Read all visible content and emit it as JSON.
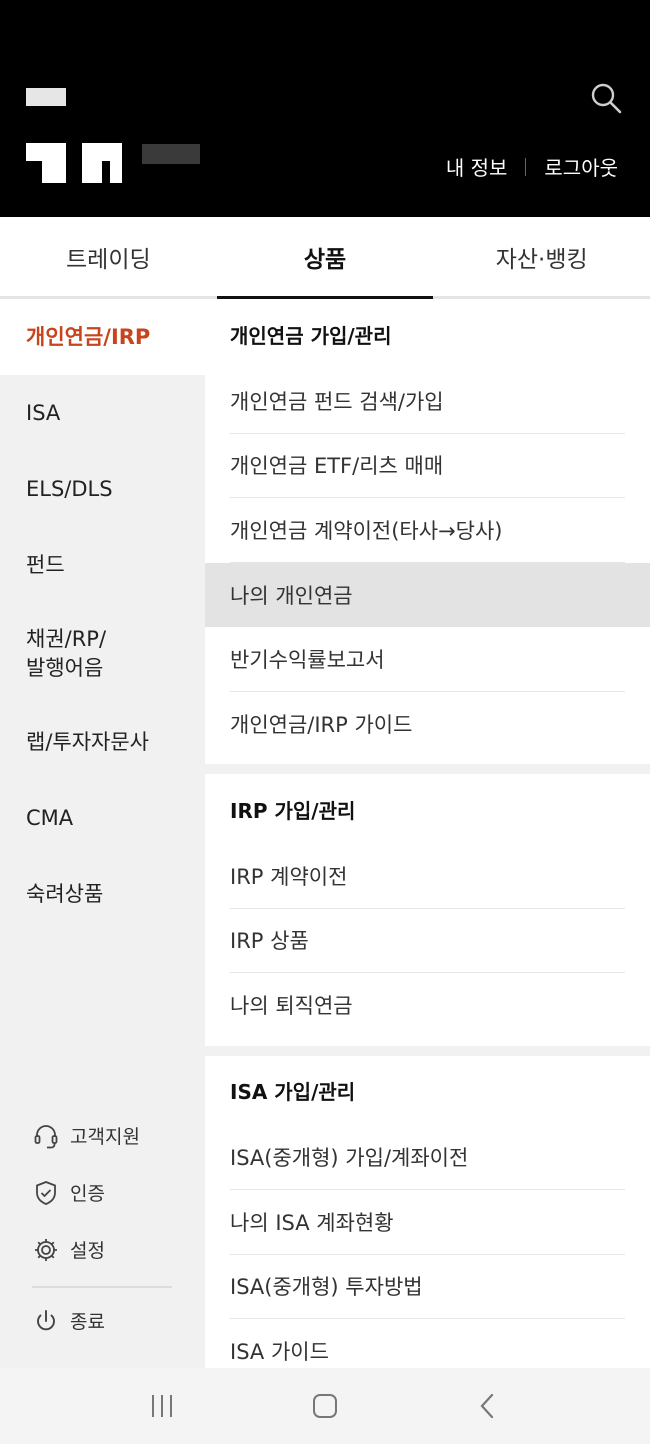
{
  "header": {
    "links": [
      "내 정보",
      "로그아웃"
    ]
  },
  "tabs": [
    {
      "label": "트레이딩",
      "active": false
    },
    {
      "label": "상품",
      "active": true
    },
    {
      "label": "자산·뱅킹",
      "active": false
    }
  ],
  "leftnav": {
    "items": [
      {
        "label": "개인연금/IRP",
        "active": true
      },
      {
        "label": "ISA"
      },
      {
        "label": "ELS/DLS"
      },
      {
        "label": "펀드"
      },
      {
        "label": "채권/RP/\n발행어음"
      },
      {
        "label": "랩/투자자문사"
      },
      {
        "label": "CMA"
      },
      {
        "label": "숙려상품"
      }
    ],
    "utilities": [
      {
        "label": "고객지원",
        "icon": "headset-icon"
      },
      {
        "label": "인증",
        "icon": "shield-check-icon"
      },
      {
        "label": "설정",
        "icon": "gear-icon"
      },
      {
        "label": "종료",
        "icon": "power-icon"
      }
    ]
  },
  "sections": [
    {
      "title": "개인연금 가입/관리",
      "links": [
        "개인연금 펀드 검색/가입",
        "개인연금 ETF/리츠 매매",
        "개인연금 계약이전(타사→당사)",
        "나의 개인연금",
        "반기수익률보고서",
        "개인연금/IRP 가이드"
      ],
      "highlight_index": 3
    },
    {
      "title": "IRP 가입/관리",
      "links": [
        "IRP 계약이전",
        "IRP 상품",
        "나의 퇴직연금"
      ]
    },
    {
      "title": "ISA 가입/관리",
      "links": [
        "ISA(중개형) 가입/계좌이전",
        "나의 ISA 계좌현황",
        "ISA(중개형) 투자방법",
        "ISA 가이드"
      ]
    }
  ],
  "colors": {
    "header_bg": "#000000",
    "accent": "#c8441c",
    "nav_bg": "#f1f1f1",
    "highlight": "#e3e3e3"
  },
  "sysbar": [
    "recent-apps-icon",
    "home-icon",
    "back-icon"
  ]
}
